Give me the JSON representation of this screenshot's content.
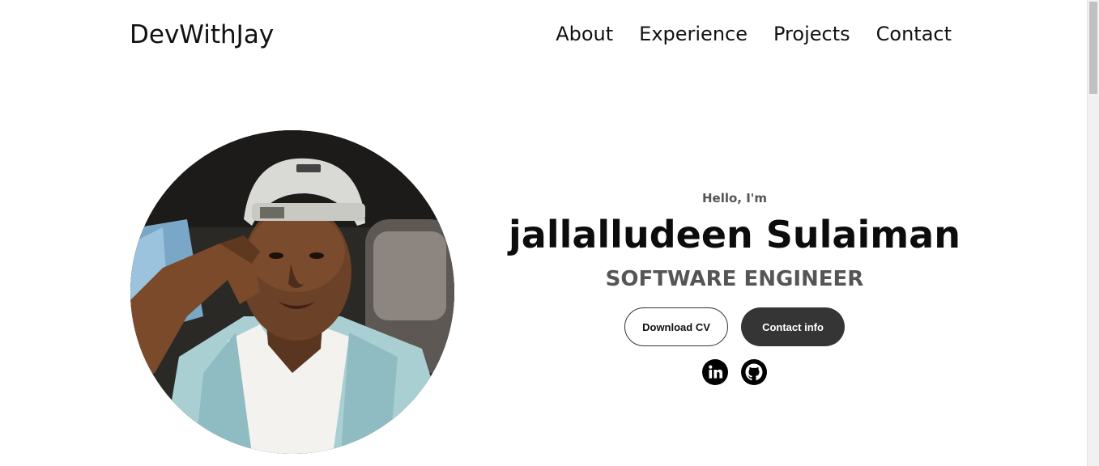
{
  "header": {
    "logo": "DevWithJay",
    "nav": [
      {
        "label": "About"
      },
      {
        "label": "Experience"
      },
      {
        "label": "Projects"
      },
      {
        "label": "Contact"
      }
    ]
  },
  "hero": {
    "greeting": "Hello, I'm",
    "name": "jallalludeen Sulaiman",
    "role": "SOFTWARE ENGINEER",
    "buttons": {
      "download_cv": "Download CV",
      "contact_info": "Contact info"
    },
    "socials": [
      {
        "icon": "linkedin-icon"
      },
      {
        "icon": "github-icon"
      }
    ],
    "photo": {
      "icon": "profile-photo"
    }
  },
  "colors": {
    "text": "#111111",
    "muted": "#555555",
    "button_dark": "#353535",
    "background": "#ffffff"
  }
}
